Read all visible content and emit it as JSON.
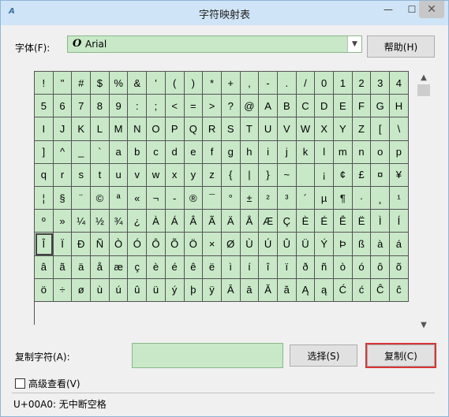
{
  "window": {
    "title": "字符映射表"
  },
  "font": {
    "label": "字体(F):",
    "value": "Arial",
    "glyph": "O"
  },
  "buttons": {
    "help": "帮助(H)",
    "select": "选择(S)",
    "copy": "复制(C)"
  },
  "copy_field": {
    "label": "复制字符(A):",
    "value": ""
  },
  "advanced": {
    "label": "高级查看(V)"
  },
  "status": {
    "text": "U+00A0: 无中断空格"
  },
  "grid": {
    "selected_index": 140,
    "chars": [
      "!",
      "\"",
      "#",
      "$",
      "%",
      "&",
      "'",
      "(",
      ")",
      "*",
      "+",
      ",",
      "-",
      ".",
      "/",
      "0",
      "1",
      "2",
      "3",
      "4",
      "5",
      "6",
      "7",
      "8",
      "9",
      ":",
      ";",
      "<",
      "=",
      ">",
      "?",
      "@",
      "A",
      "B",
      "C",
      "D",
      "E",
      "F",
      "G",
      "H",
      "I",
      "J",
      "K",
      "L",
      "M",
      "N",
      "O",
      "P",
      "Q",
      "R",
      "S",
      "T",
      "U",
      "V",
      "W",
      "X",
      "Y",
      "Z",
      "[",
      "\\",
      "]",
      "^",
      "_",
      "`",
      "a",
      "b",
      "c",
      "d",
      "e",
      "f",
      "g",
      "h",
      "i",
      "j",
      "k",
      "l",
      "m",
      "n",
      "o",
      "p",
      "q",
      "r",
      "s",
      "t",
      "u",
      "v",
      "w",
      "x",
      "y",
      "z",
      "{",
      "|",
      "}",
      "~",
      "",
      "¡",
      "¢",
      "£",
      "¤",
      "¥",
      "¦",
      "§",
      "¨",
      "©",
      "ª",
      "«",
      "¬",
      "-",
      "®",
      "¯",
      "°",
      "±",
      "²",
      "³",
      "´",
      "µ",
      "¶",
      "·",
      "¸",
      "¹",
      "º",
      "»",
      "¼",
      "½",
      "¾",
      "¿",
      "À",
      "Á",
      "Â",
      "Ã",
      "Ä",
      "Å",
      "Æ",
      "Ç",
      "È",
      "É",
      "Ê",
      "Ë",
      "Ì",
      "Í",
      "Î",
      "Ï",
      "Ð",
      "Ñ",
      "Ò",
      "Ó",
      "Ô",
      "Õ",
      "Ö",
      "×",
      "Ø",
      "Ù",
      "Ú",
      "Û",
      "Ü",
      "Ý",
      "Þ",
      "ß",
      "à",
      "á",
      "â",
      "ã",
      "ä",
      "å",
      "æ",
      "ç",
      "è",
      "é",
      "ê",
      "ë",
      "ì",
      "í",
      "î",
      "ï",
      "ð",
      "ñ",
      "ò",
      "ó",
      "ô",
      "õ",
      "ö",
      "÷",
      "ø",
      "ù",
      "ú",
      "û",
      "ü",
      "ý",
      "þ",
      "ÿ",
      "Ā",
      "ā",
      "Ă",
      "ă",
      "Ą",
      "ą",
      "Ć",
      "ć",
      "Ĉ",
      "ĉ"
    ]
  }
}
